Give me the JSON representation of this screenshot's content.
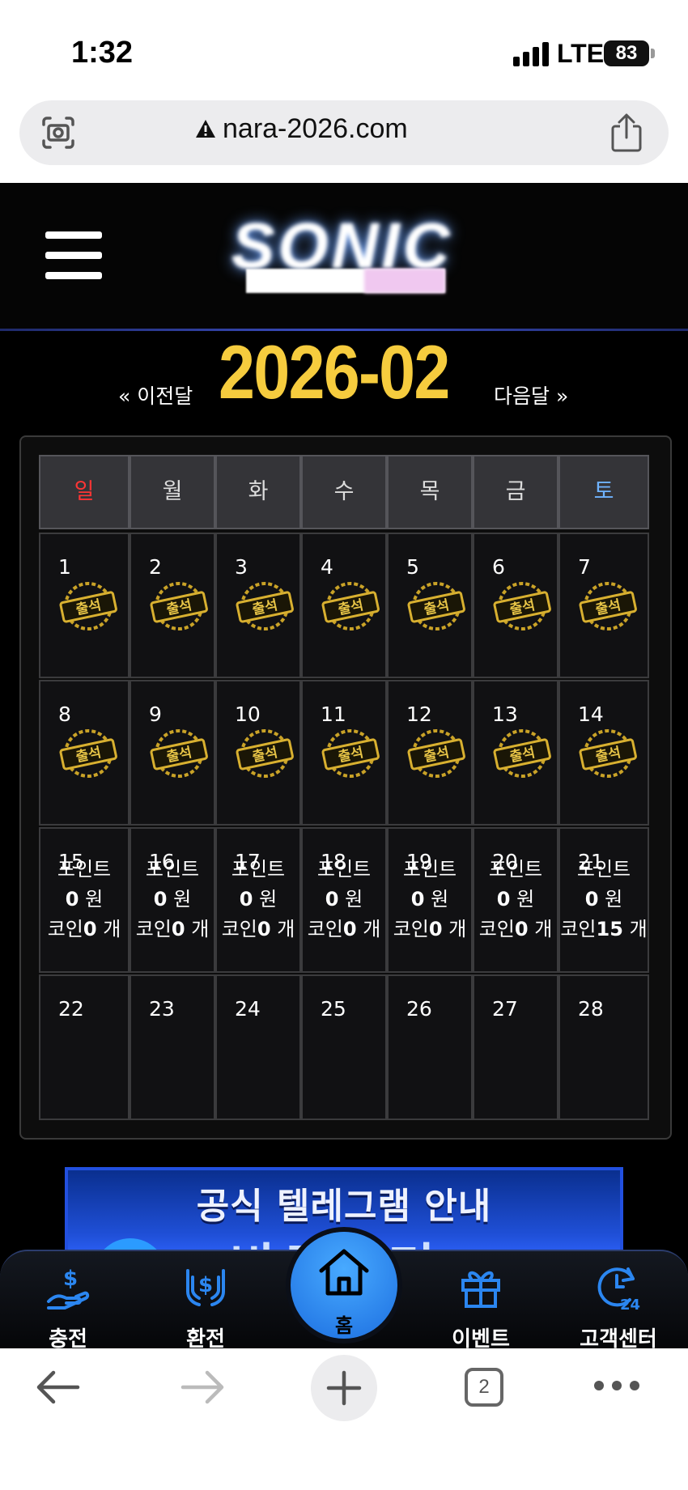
{
  "status_bar": {
    "time": "1:32",
    "network": "LTE",
    "battery": "83"
  },
  "browser": {
    "url": "nara-2026.com",
    "tabs_count": "2"
  },
  "header": {
    "logo_text": "SONIC"
  },
  "calendar": {
    "prev_label": "« 이전달",
    "month": "2026-02",
    "next_label": "다음달 »",
    "weekdays": [
      "일",
      "월",
      "화",
      "수",
      "목",
      "금",
      "토"
    ],
    "stamp_label": "출석",
    "week1": [
      "1",
      "2",
      "3",
      "4",
      "5",
      "6",
      "7"
    ],
    "week2": [
      "8",
      "9",
      "10",
      "11",
      "12",
      "13",
      "14"
    ],
    "week3": [
      "15",
      "16",
      "17",
      "18",
      "19",
      "20",
      "21"
    ],
    "week4": [
      "22",
      "23",
      "24",
      "25",
      "26",
      "27",
      "28"
    ],
    "point_label": "포인트",
    "point_unit": "원",
    "coin_label": "코인",
    "coin_unit": "개",
    "points": [
      "0",
      "0",
      "0",
      "0",
      "0",
      "0",
      "0"
    ],
    "coins": [
      "0",
      "0",
      "0",
      "0",
      "0",
      "0",
      "15"
    ]
  },
  "banner": {
    "title": "공식 텔레그램 안내",
    "subtitle": "바로가기 CLICK"
  },
  "bottom_nav": {
    "charge": "충전",
    "exchange": "환전",
    "home": "홈",
    "event": "이벤트",
    "support": "고객센터"
  },
  "colors": {
    "accent_gold": "#f6cc3e",
    "sunday": "#ff3535",
    "saturday": "#6fb3ff",
    "nav_blue": "#2b86f0"
  }
}
